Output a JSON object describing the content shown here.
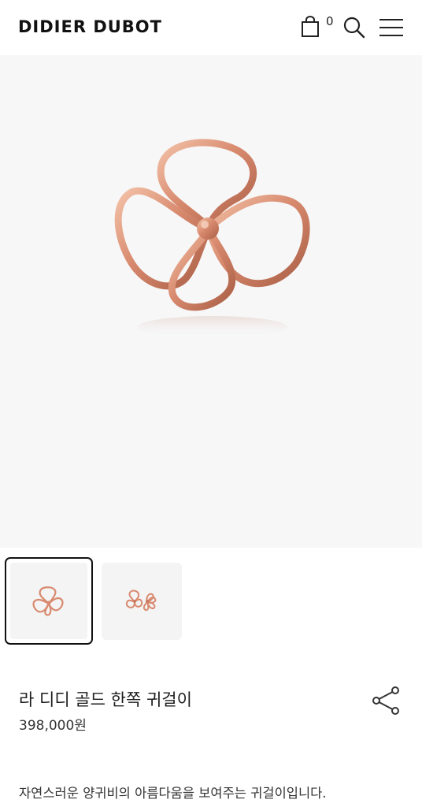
{
  "header": {
    "logo": "DIDIER DUBOT",
    "cart_count": "0",
    "icons": [
      "shopping-bag-icon",
      "search-icon",
      "hamburger-menu-icon"
    ]
  },
  "hero": {
    "image": "rose-gold-earring-image",
    "background": "#f7f7f8"
  },
  "thumbnails": [
    {
      "image": "single-earring-thumbnail",
      "selected": true
    },
    {
      "image": "earring-pair-thumbnail",
      "selected": false
    }
  ],
  "product": {
    "name": "라 디디 골드 한쪽 귀걸이",
    "price": "398,000원",
    "share_icon": "share-icon",
    "description": "자연스러운 양귀비의 아름다움을 보여주는 귀걸이입니다."
  },
  "colors": {
    "rose_gold": "#d88a6e",
    "rose_gold_dark": "#b8694f",
    "text": "#222222"
  }
}
